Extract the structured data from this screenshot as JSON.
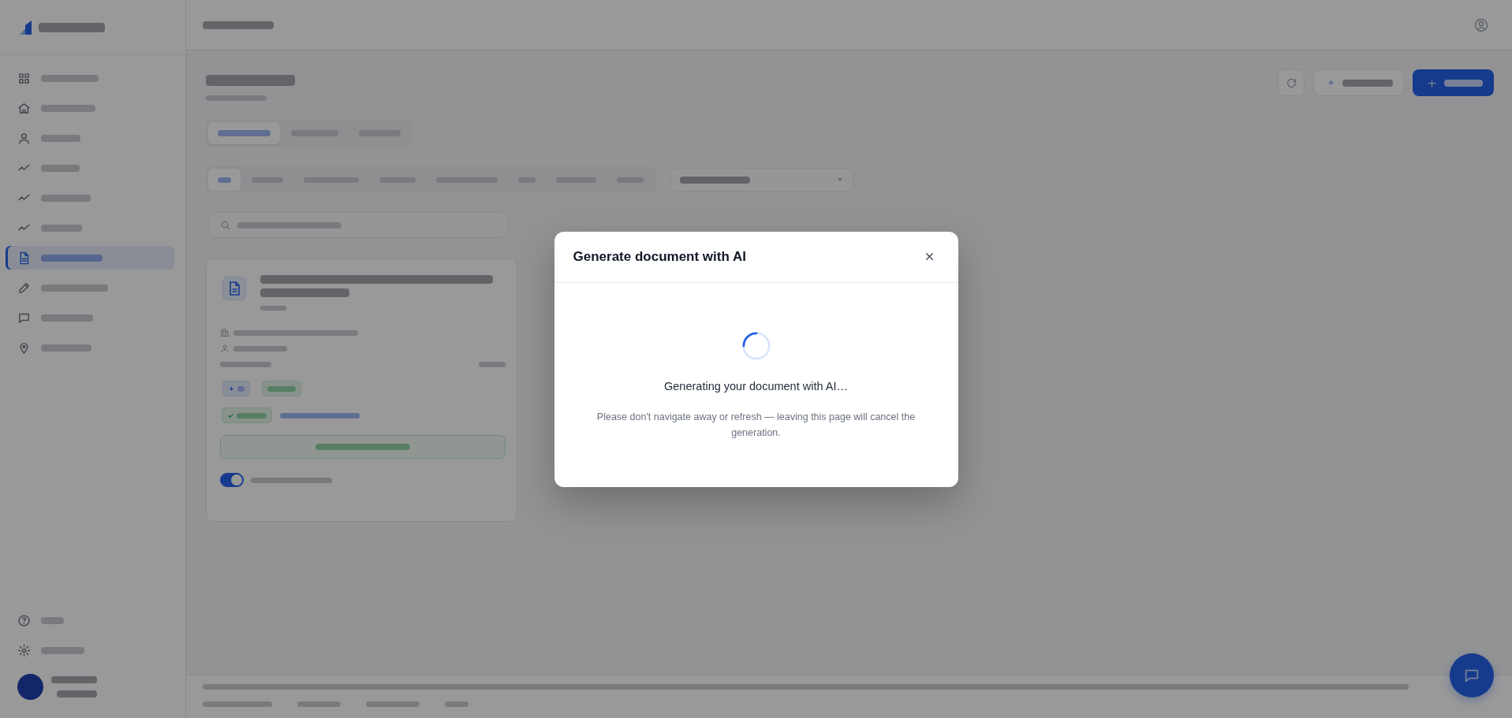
{
  "sidebar": {
    "items": [
      {
        "selected": false
      },
      {
        "selected": false
      },
      {
        "selected": false
      },
      {
        "selected": false
      },
      {
        "selected": false
      },
      {
        "selected": false
      },
      {
        "selected": true
      },
      {
        "selected": false
      },
      {
        "selected": false
      },
      {
        "selected": false
      }
    ]
  },
  "header": {
    "buttons": [
      {
        "kind": "icon"
      },
      {
        "kind": "secondary"
      },
      {
        "kind": "primary"
      }
    ]
  },
  "tabs": [
    {
      "selected": true
    },
    {
      "selected": false
    },
    {
      "selected": false
    }
  ],
  "filters": [
    {
      "selected": true
    },
    {
      "selected": false
    },
    {
      "selected": false
    },
    {
      "selected": false
    },
    {
      "selected": false
    },
    {
      "selected": false
    },
    {
      "selected": false
    },
    {
      "selected": false
    }
  ],
  "documents": [
    {
      "badges": [
        {
          "kind": "ai"
        },
        {
          "kind": "status"
        }
      ],
      "shared": {
        "on": true
      }
    }
  ],
  "modal": {
    "title": "Generate document with AI",
    "status": "Generating your document with AI…",
    "note": "Please don't navigate away or refresh — leaving this page will cancel the generation."
  }
}
